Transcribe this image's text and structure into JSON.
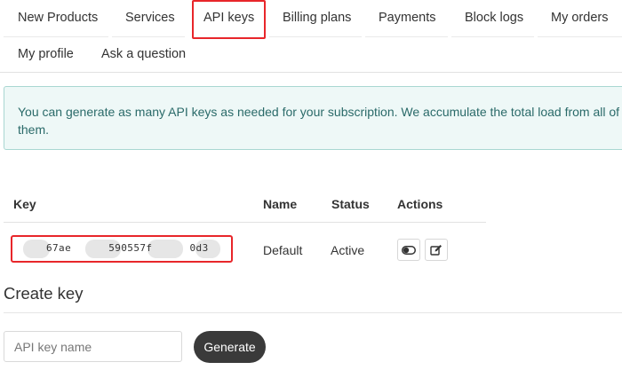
{
  "nav": {
    "tabs": [
      {
        "label": "New Products"
      },
      {
        "label": "Services"
      },
      {
        "label": "API keys"
      },
      {
        "label": "Billing plans"
      },
      {
        "label": "Payments"
      },
      {
        "label": "Block logs"
      },
      {
        "label": "My orders"
      },
      {
        "label": "My profile"
      },
      {
        "label": "Ask a question"
      }
    ],
    "active_tab": "API keys"
  },
  "alert": {
    "text": "You can generate as many API keys as needed for your subscription. We accumulate the total load from all of them."
  },
  "keys_table": {
    "headers": {
      "key": "Key",
      "name": "Name",
      "status": "Status",
      "actions": "Actions"
    },
    "rows": [
      {
        "key": "67ae      590557f      0d3    7c",
        "name": "Default",
        "status": "Active"
      }
    ]
  },
  "create_key": {
    "title": "Create key",
    "input_placeholder": "API key name",
    "input_value": "",
    "button_label": "Generate"
  },
  "colors": {
    "highlight": "#e8262a",
    "alert_bg": "#eef8f7",
    "alert_border": "#a9d7d2",
    "alert_text": "#2a6a69",
    "button_bg": "#3a3a3a"
  },
  "icons": {
    "toggle": "toggle-icon",
    "edit": "edit-icon"
  }
}
